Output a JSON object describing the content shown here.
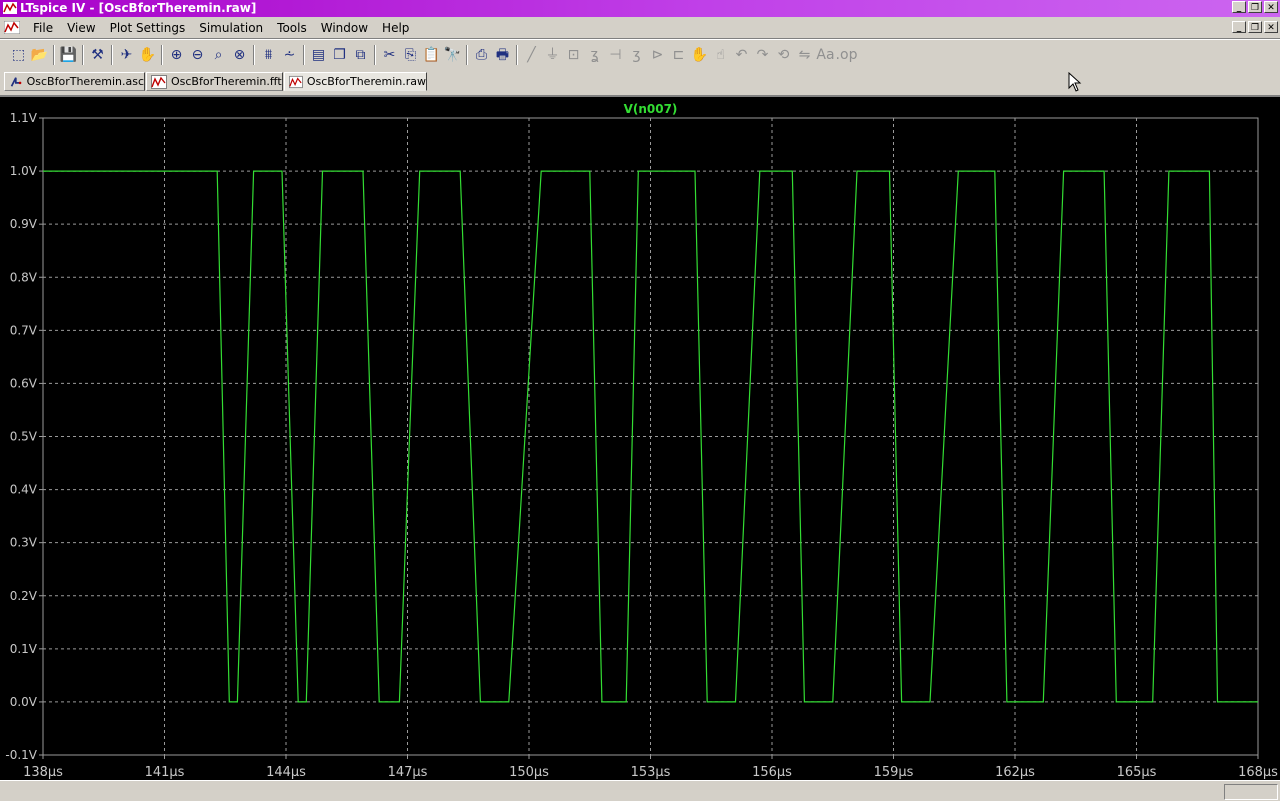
{
  "window": {
    "title": "LTspice IV - [OscBforTheremin.raw]"
  },
  "menu": [
    "File",
    "View",
    "Plot Settings",
    "Simulation",
    "Tools",
    "Window",
    "Help"
  ],
  "toolbar": {
    "icons": [
      "new-schematic-icon",
      "open-icon",
      "save-icon",
      "control-panel-icon",
      "run-icon",
      "halt-icon",
      "zoom-in-icon",
      "zoom-out-icon",
      "zoom-fit-icon",
      "zoom-cancel-icon",
      "autorange-icon",
      "add-trace-icon",
      "tile-icon",
      "cascade-icon",
      "close-all-icon",
      "cut-icon",
      "copy-icon",
      "paste-icon",
      "find-icon",
      "print-preview-icon",
      "print-icon",
      "wire-icon",
      "ground-icon",
      "label-icon",
      "resistor-icon",
      "capacitor-icon",
      "inductor-icon",
      "diode-icon",
      "component-icon",
      "move-icon",
      "drag-icon",
      "undo-icon",
      "redo-icon",
      "rotate-icon",
      "mirror-icon",
      "text-icon",
      "spice-directive-icon"
    ]
  },
  "tabs": [
    {
      "label": "OscBforTheremin.asc",
      "icon": "schematic-icon",
      "active": false
    },
    {
      "label": "OscBforTheremin.fft",
      "icon": "waveform-icon",
      "active": false
    },
    {
      "label": "OscBforTheremin.raw",
      "icon": "waveform-icon",
      "active": true
    }
  ],
  "colors": {
    "trace": "#33dd33",
    "plot_bg": "#000000",
    "grid": "#9a9a9a",
    "axis_text": "#c8c8c8",
    "title_gradient_start": "#a800c8"
  },
  "chart_data": {
    "type": "line",
    "title": "V(n007)",
    "xlabel": "",
    "ylabel": "",
    "xlim": [
      138,
      168
    ],
    "ylim": [
      -0.1,
      1.1
    ],
    "x_unit": "µs",
    "y_unit": "V",
    "grid": true,
    "x_ticks": [
      "138µs",
      "141µs",
      "144µs",
      "147µs",
      "150µs",
      "153µs",
      "156µs",
      "159µs",
      "162µs",
      "165µs",
      "168µs"
    ],
    "y_ticks": [
      "1.1V",
      "1.0V",
      "0.9V",
      "0.8V",
      "0.7V",
      "0.6V",
      "0.5V",
      "0.4V",
      "0.3V",
      "0.2V",
      "0.1V",
      "0.0V",
      "-0.1V"
    ],
    "series": [
      {
        "name": "V(n007)",
        "x": [
          138.0,
          142.3,
          142.6,
          142.8,
          143.2,
          143.9,
          144.3,
          144.5,
          144.9,
          145.9,
          146.3,
          146.8,
          147.3,
          148.3,
          148.8,
          149.5,
          150.3,
          151.5,
          151.8,
          152.4,
          152.7,
          154.1,
          154.4,
          155.1,
          155.7,
          156.5,
          156.8,
          157.5,
          158.1,
          158.9,
          159.2,
          159.9,
          160.6,
          161.5,
          161.8,
          162.7,
          163.2,
          164.2,
          164.5,
          165.4,
          165.8,
          166.8,
          167.0,
          168.0
        ],
        "y": [
          1.0,
          1.0,
          0.0,
          0.0,
          1.0,
          1.0,
          0.0,
          0.0,
          1.0,
          1.0,
          0.0,
          0.0,
          1.0,
          1.0,
          0.0,
          0.0,
          1.0,
          1.0,
          0.0,
          0.0,
          1.0,
          1.0,
          0.0,
          0.0,
          1.0,
          1.0,
          0.0,
          0.0,
          1.0,
          1.0,
          0.0,
          0.0,
          1.0,
          1.0,
          0.0,
          0.0,
          1.0,
          1.0,
          0.0,
          0.0,
          1.0,
          1.0,
          0.0,
          0.0
        ]
      }
    ]
  }
}
